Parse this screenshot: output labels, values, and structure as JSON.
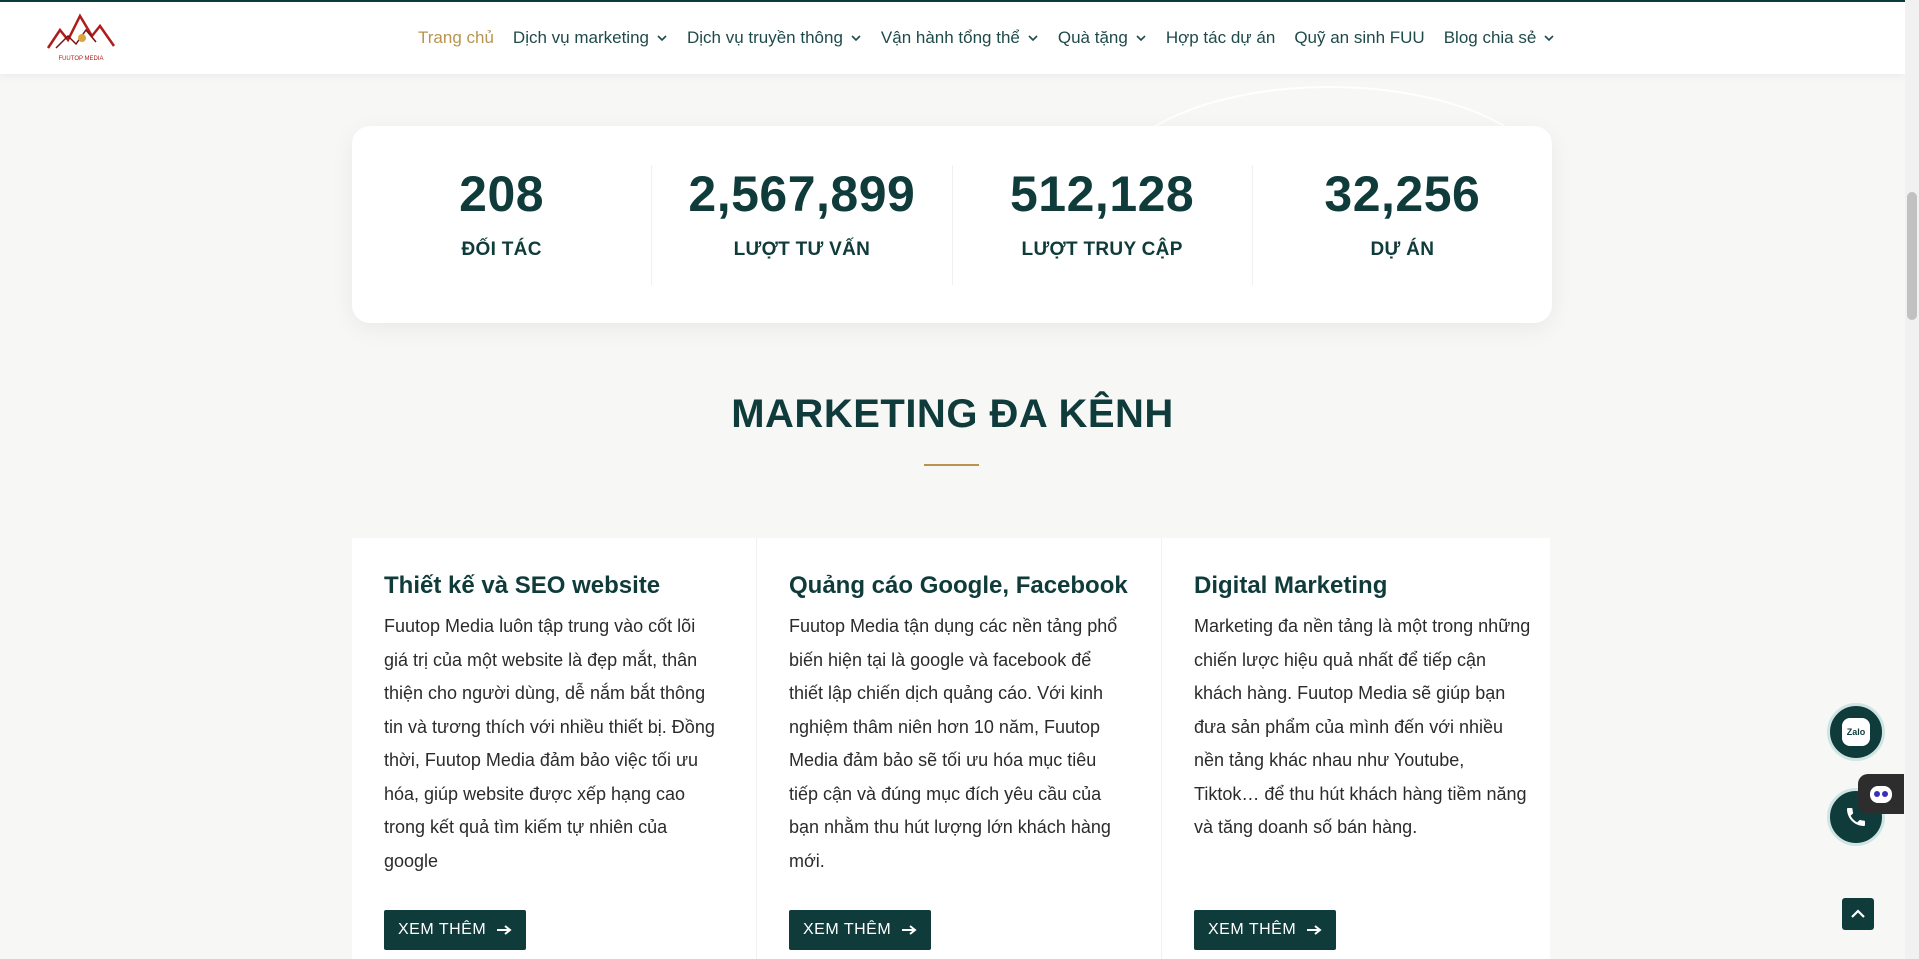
{
  "logo": {
    "brand_text": "FUUTOP MEDIA"
  },
  "nav": {
    "items": [
      {
        "label": "Trang chủ",
        "active": true,
        "dropdown": false
      },
      {
        "label": "Dịch vụ marketing",
        "active": false,
        "dropdown": true
      },
      {
        "label": "Dịch vụ truyền thông",
        "active": false,
        "dropdown": true
      },
      {
        "label": "Vận hành tổng thể",
        "active": false,
        "dropdown": true
      },
      {
        "label": "Quà tặng",
        "active": false,
        "dropdown": true
      },
      {
        "label": "Hợp tác dự án",
        "active": false,
        "dropdown": false
      },
      {
        "label": "Quỹ an sinh FUU",
        "active": false,
        "dropdown": false
      },
      {
        "label": "Blog chia sẻ",
        "active": false,
        "dropdown": true
      }
    ]
  },
  "stats": [
    {
      "value": "208",
      "label": "ĐỐI TÁC"
    },
    {
      "value": "2,567,899",
      "label": "LƯỢT TƯ VẤN"
    },
    {
      "value": "512,128",
      "label": "LƯỢT TRUY CẬP"
    },
    {
      "value": "32,256",
      "label": "DỰ ÁN"
    }
  ],
  "section": {
    "title": "MARKETING ĐA KÊNH"
  },
  "cards": [
    {
      "title": "Thiết kế và SEO website",
      "body": "Fuutop Media luôn tập trung vào cốt lõi giá trị của một website là đẹp mắt, thân thiện cho người dùng, dễ nắm bắt thông tin và tương thích với nhiều thiết bị. Đồng thời, Fuutop Media đảm bảo việc tối ưu hóa, giúp website được xếp hạng cao trong kết quả tìm kiếm tự nhiên của google",
      "button": "XEM THÊM"
    },
    {
      "title": "Quảng cáo Google, Facebook",
      "body": "Fuutop Media tận dụng các nền tảng phổ biến hiện tại là google và facebook để thiết lập chiến dịch quảng cáo. Với kinh nghiệm thâm niên hơn 10 năm, Fuutop Media đảm bảo sẽ tối ưu hóa mục tiêu tiếp cận và đúng mục đích yêu cầu của bạn nhằm thu hút lượng lớn khách hàng mới.",
      "button": "XEM THÊM"
    },
    {
      "title": "Digital Marketing",
      "body": "Marketing đa nền tảng là một trong những chiến lược hiệu quả nhất để tiếp cận khách hàng. Fuutop Media sẽ giúp bạn đưa sản phẩm của mình đến với nhiều nền tảng khác nhau như Youtube, Tiktok… để thu hút khách hàng tiềm năng và tăng doanh số bán hàng.",
      "button": "XEM THÊM"
    }
  ],
  "floating": {
    "zalo_label": "Zalo"
  },
  "colors": {
    "primary": "#0f3b3a",
    "accent": "#b8944f",
    "background": "#f7f7f6"
  }
}
